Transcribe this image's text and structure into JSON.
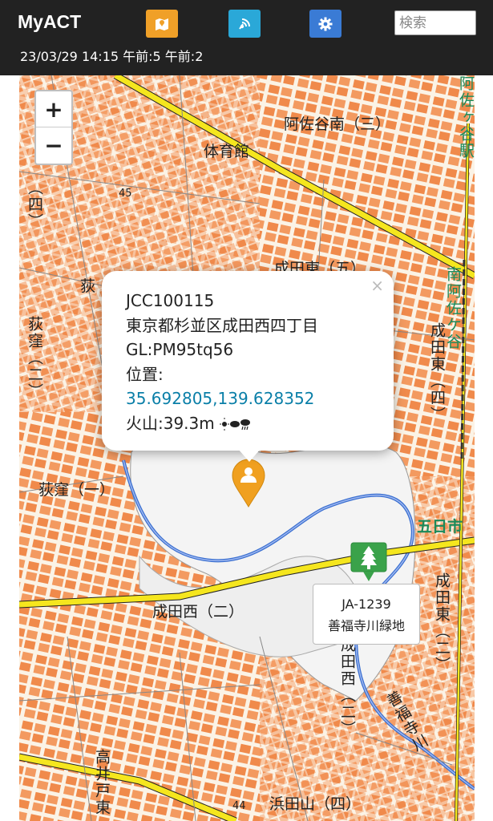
{
  "app": {
    "title": "MyACT"
  },
  "header": {
    "buttons": [
      {
        "icon": "map-icon",
        "color": "#f0a028"
      },
      {
        "icon": "radio-signal-icon",
        "color": "#2aa8d8"
      },
      {
        "icon": "gear-icon",
        "color": "#3a7bd5"
      }
    ],
    "search_placeholder": "検索",
    "status": "23/03/29 14:15 午前:5 午前:2"
  },
  "map": {
    "zoom_in": "+",
    "zoom_out": "−",
    "labels": {
      "asagaya_minami": "阿佐谷南（三）",
      "taiikukan": "体育館",
      "asagaya_eki": "阿佐ヶ谷駅",
      "minami_asagaya": "南阿佐ケ谷",
      "narita_higashi_5": "成田東（五）",
      "narita_higashi_4": "成田東（四）",
      "narita_higashi_2": "成田東（二）",
      "ogikubo_1": "荻窪（一）",
      "ogikubo_2": "荻窪（二）",
      "ogi": "荻",
      "narita_nishi_2": "成田西（二）",
      "narita_nishi_r": "成田西（二）",
      "itsukaichi": "五日市",
      "zenpukuji": "善福寺川",
      "takaido_higashi": "高井戸東",
      "hamadayama": "浜田山（四）",
      "num45": "45",
      "num44": "44",
      "yon": "（四）"
    }
  },
  "popup": {
    "call": "JCC100115",
    "address": "東京都杉並区成田西四丁目",
    "grid": "GL:PM95tq56",
    "position_label": "位置:",
    "coordinates": "35.692805,139.628352",
    "elevation": "火山:39.3m",
    "weather_icon": "sun-cloud-rain-icon",
    "close": "×"
  },
  "park": {
    "ref": "JA-1239",
    "name": "善福寺川緑地"
  },
  "colors": {
    "header_bg": "#222222",
    "road_yellow": "#f5e61e",
    "block_orange": "#f08a4b",
    "river_blue": "#3a6fd0",
    "user_marker": "#f0a020",
    "park_marker": "#3aa24a",
    "coord_link": "#0a7fa8"
  }
}
